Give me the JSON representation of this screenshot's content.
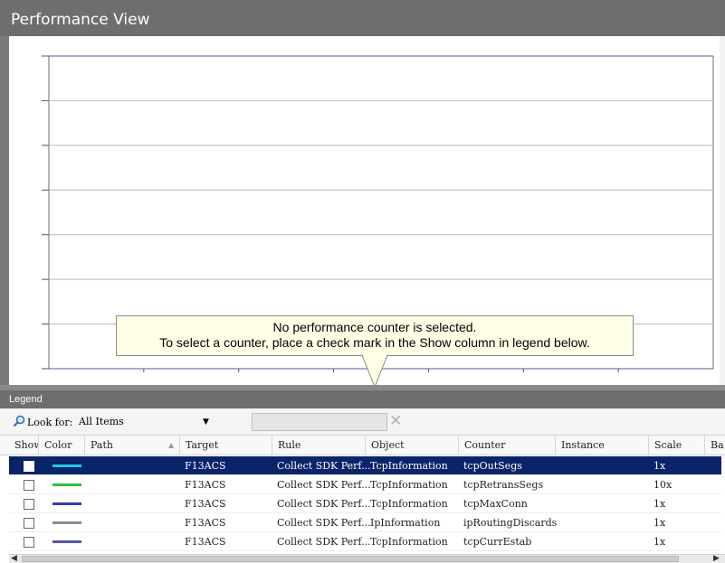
{
  "header": {
    "title": "Performance View"
  },
  "tooltip": {
    "line1": "No performance counter is selected.",
    "line2": "To select a counter, place a check mark in the Show column in legend below."
  },
  "legend": {
    "title": "Legend",
    "look_for_label": "Look for:",
    "look_for_value": "All Items",
    "filter_value": "",
    "columns": [
      "Show",
      "Color",
      "Path",
      "Target",
      "Rule",
      "Object",
      "Counter",
      "Instance",
      "Scale",
      "Ba"
    ],
    "rows": [
      {
        "color": "#22c8e6",
        "path": "",
        "target": "F13ACS",
        "rule": "Collect SDK Perf...",
        "object": "TcpInformation",
        "counter": "tcpOutSegs",
        "instance": "",
        "scale": "1x",
        "selected": true
      },
      {
        "color": "#2fbf3f",
        "path": "",
        "target": "F13ACS",
        "rule": "Collect SDK Perf...",
        "object": "TcpInformation",
        "counter": "tcpRetransSegs",
        "instance": "",
        "scale": "10x",
        "selected": false
      },
      {
        "color": "#3a3ab4",
        "path": "",
        "target": "F13ACS",
        "rule": "Collect SDK Perf...",
        "object": "TcpInformation",
        "counter": "tcpMaxConn",
        "instance": "",
        "scale": "1x",
        "selected": false
      },
      {
        "color": "#8c8c8c",
        "path": "",
        "target": "F13ACS",
        "rule": "Collect SDK Perf...",
        "object": "IpInformation",
        "counter": "ipRoutingDiscards",
        "instance": "",
        "scale": "1x",
        "selected": false
      },
      {
        "color": "#5454b0",
        "path": "",
        "target": "F13ACS",
        "rule": "Collect SDK Perf...",
        "object": "TcpInformation",
        "counter": "tcpCurrEstab",
        "instance": "",
        "scale": "1x",
        "selected": false
      }
    ]
  },
  "colors": {
    "header_bg": "#6e6e6e",
    "selection": "#0a246a",
    "plot_line": "#7c7ca8",
    "tooltip_bg": "#ffffe6"
  }
}
